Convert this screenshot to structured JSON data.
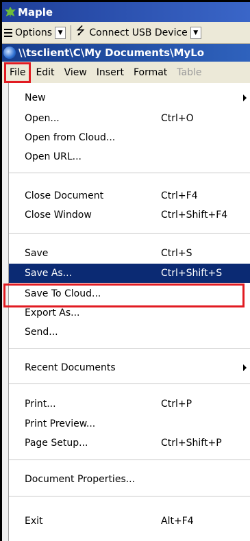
{
  "window": {
    "title": "Maple"
  },
  "toolbar": {
    "options_label": "Options",
    "usb_label": "Connect USB Device"
  },
  "document": {
    "path": "\\\\tsclient\\C\\My Documents\\MyLo"
  },
  "menubar": {
    "items": [
      {
        "label": "File",
        "state": "active"
      },
      {
        "label": "Edit"
      },
      {
        "label": "View"
      },
      {
        "label": "Insert"
      },
      {
        "label": "Format"
      },
      {
        "label": "Table",
        "state": "disabled"
      }
    ]
  },
  "file_menu": {
    "items": [
      {
        "label": "New",
        "shortcut": "",
        "submenu": true
      },
      {
        "label": "Open...",
        "shortcut": "Ctrl+O"
      },
      {
        "label": "Open from Cloud...",
        "shortcut": ""
      },
      {
        "label": "Open URL...",
        "shortcut": ""
      },
      {
        "label": "Close Document",
        "shortcut": "Ctrl+F4"
      },
      {
        "label": "Close Window",
        "shortcut": "Ctrl+Shift+F4"
      },
      {
        "label": "Save",
        "shortcut": "Ctrl+S"
      },
      {
        "label": "Save As...",
        "shortcut": "Ctrl+Shift+S",
        "highlighted": true
      },
      {
        "label": "Save To Cloud...",
        "shortcut": ""
      },
      {
        "label": "Export As...",
        "shortcut": ""
      },
      {
        "label": "Send...",
        "shortcut": ""
      },
      {
        "label": "Recent Documents",
        "shortcut": "",
        "submenu": true
      },
      {
        "label": "Print...",
        "shortcut": "Ctrl+P"
      },
      {
        "label": "Print Preview...",
        "shortcut": ""
      },
      {
        "label": "Page Setup...",
        "shortcut": "Ctrl+Shift+P"
      },
      {
        "label": "Document Properties...",
        "shortcut": ""
      },
      {
        "label": "Exit",
        "shortcut": "Alt+F4"
      }
    ]
  },
  "colors": {
    "highlight": "#0b2a73",
    "annotation_red": "#e11b22",
    "titlebar": "#1f3f99"
  }
}
